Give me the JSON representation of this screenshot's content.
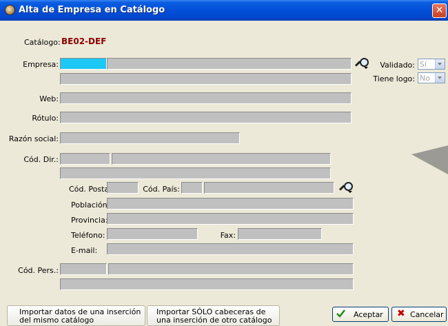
{
  "window": {
    "title": "Alta de Empresa en Catálogo",
    "close_glyph": "✕"
  },
  "catalogo": {
    "label": "Catálogo:",
    "value": "BE02-DEF",
    "value_color": "#8b0000"
  },
  "labels": {
    "empresa": "Empresa:",
    "web": "Web:",
    "rotulo": "Rótulo:",
    "razon_social": "Razón social:",
    "cod_dir": "Cód. Dir.:",
    "cod_postal": "Cód. Postal:",
    "cod_pais": "Cód. País:",
    "poblacion": "Población:",
    "provincia": "Provincia:",
    "telefono": "Teléfono:",
    "fax": "Fax:",
    "email": "E-mail:",
    "cod_pers": "Cód. Pers.:"
  },
  "validado": {
    "label": "Validado:",
    "value": "Sí"
  },
  "tiene_logo": {
    "label": "Tiene logo:",
    "value": "No"
  },
  "buttons": {
    "importar_mismo": [
      "Importar datos de una inserción",
      "del mismo catálogo"
    ],
    "importar_otro": [
      "Importar SÓLO cabeceras de",
      "una inserción de otro catálogo"
    ],
    "aceptar": "Aceptar",
    "cancelar": "Cancelar"
  },
  "icons": {
    "title": "app-icon",
    "search": "magnifier-icon",
    "aceptar": "checkmark-icon",
    "cancelar": "x-icon"
  },
  "colors": {
    "field_active": "#1ec8f5",
    "field_disabled": "#c0c0c0",
    "titlebar": "#0350d9"
  }
}
